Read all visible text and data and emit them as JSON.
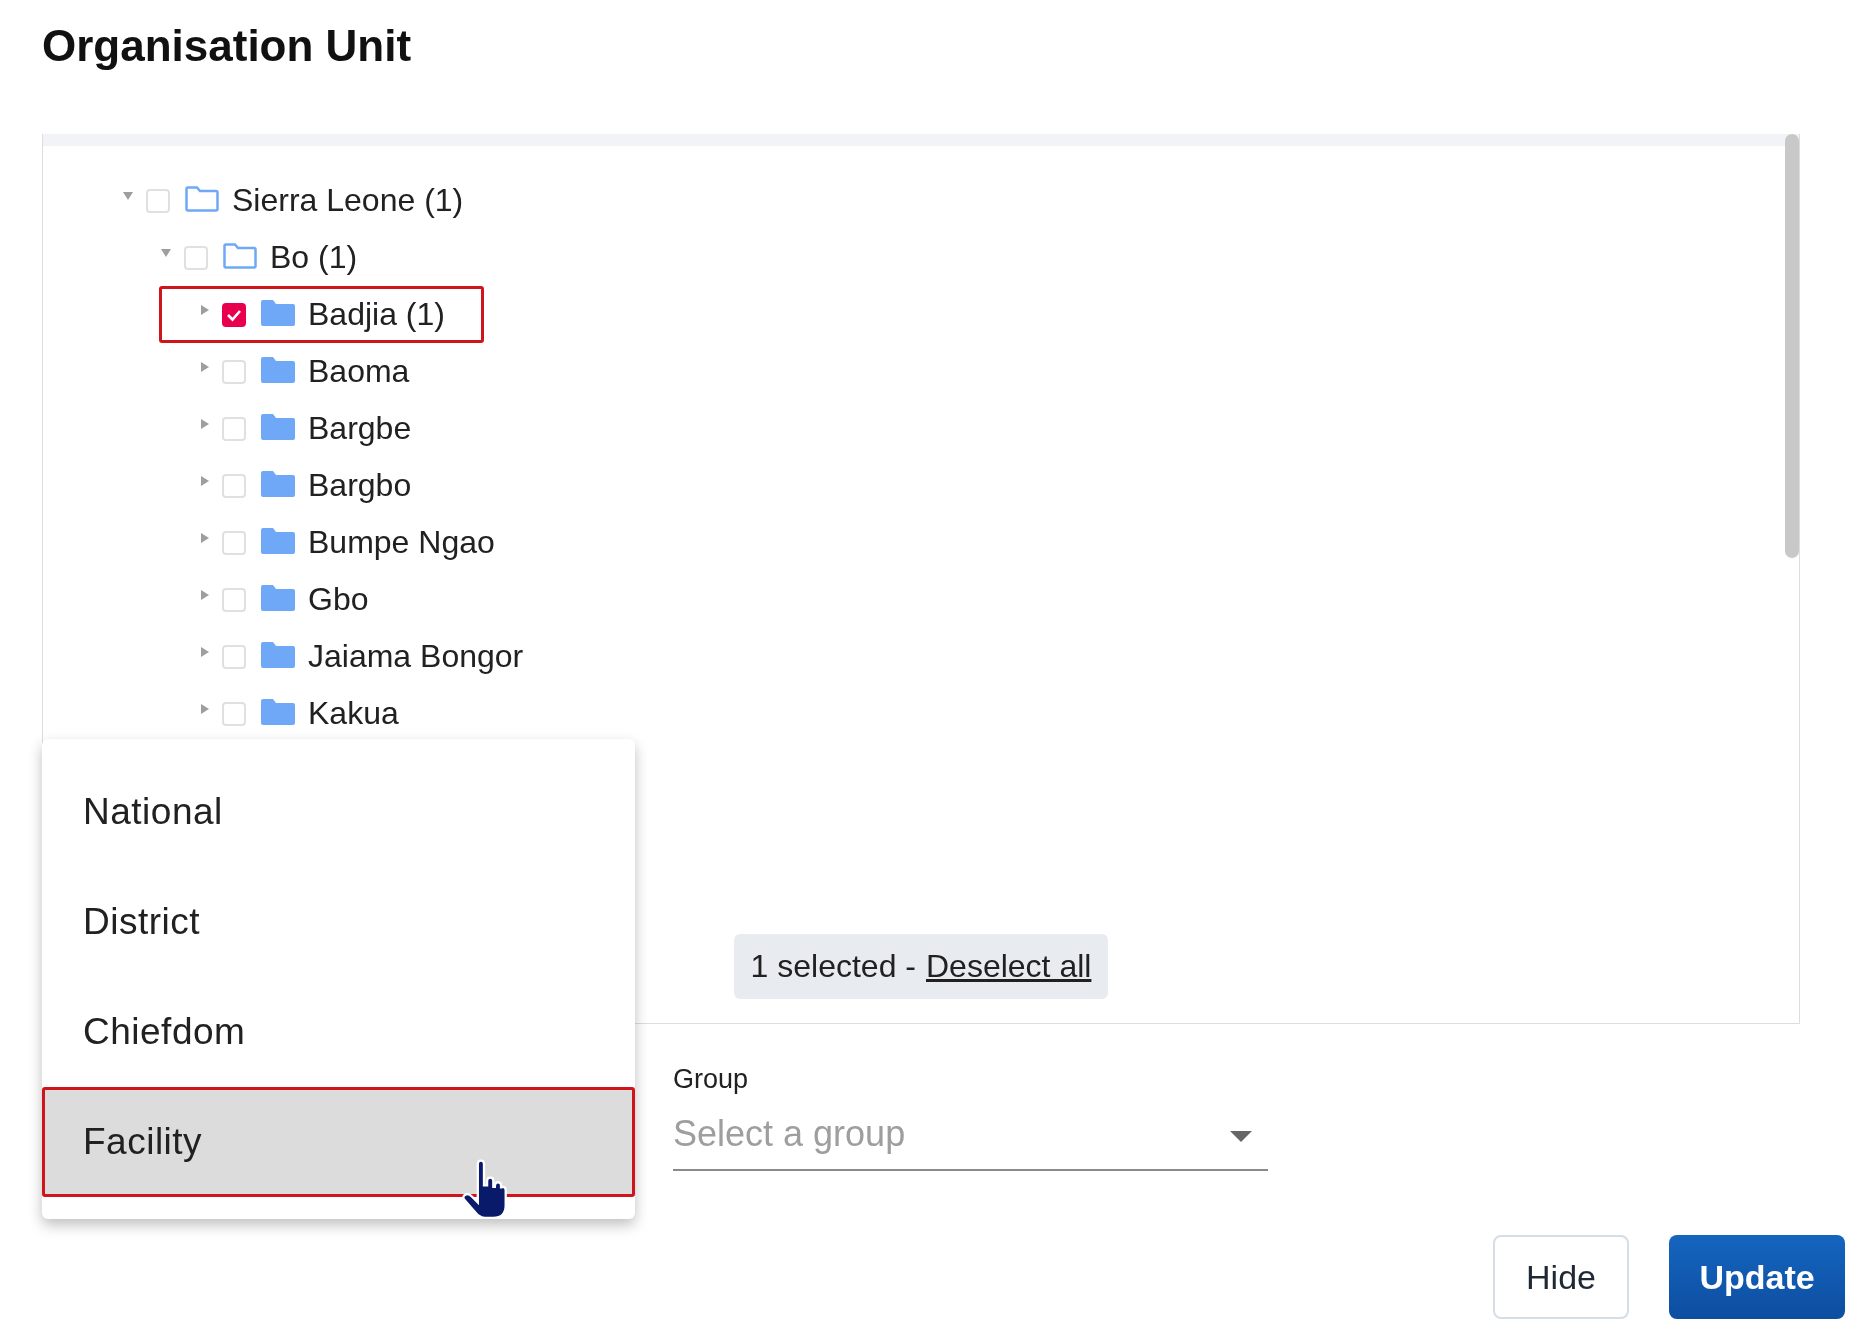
{
  "title": "Organisation Unit",
  "tree": [
    {
      "label": "Sierra Leone (1)",
      "expanded": true,
      "checked": false,
      "highlighted": false,
      "children": [
        {
          "label": "Bo (1)",
          "expanded": true,
          "checked": false,
          "highlighted": false,
          "children": [
            {
              "label": "Badjia (1)",
              "expanded": false,
              "checked": true,
              "highlighted": true
            },
            {
              "label": "Baoma",
              "expanded": false,
              "checked": false,
              "highlighted": false
            },
            {
              "label": "Bargbe",
              "expanded": false,
              "checked": false,
              "highlighted": false
            },
            {
              "label": "Bargbo",
              "expanded": false,
              "checked": false,
              "highlighted": false
            },
            {
              "label": "Bumpe Ngao",
              "expanded": false,
              "checked": false,
              "highlighted": false
            },
            {
              "label": "Gbo",
              "expanded": false,
              "checked": false,
              "highlighted": false
            },
            {
              "label": "Jaiama Bongor",
              "expanded": false,
              "checked": false,
              "highlighted": false
            },
            {
              "label": "Kakua",
              "expanded": false,
              "checked": false,
              "highlighted": false
            }
          ]
        }
      ]
    }
  ],
  "selection": {
    "count_text": "1 selected -",
    "link": "Deselect all"
  },
  "level_menu": [
    {
      "label": "National",
      "selected": false,
      "highlighted": false
    },
    {
      "label": "District",
      "selected": false,
      "highlighted": false
    },
    {
      "label": "Chiefdom",
      "selected": false,
      "highlighted": false
    },
    {
      "label": "Facility",
      "selected": true,
      "highlighted": true
    }
  ],
  "group": {
    "label": "Group",
    "placeholder": "Select a group"
  },
  "buttons": [
    {
      "label": "Hide",
      "kind": "secondary"
    },
    {
      "label": "Update",
      "kind": "primary"
    }
  ]
}
